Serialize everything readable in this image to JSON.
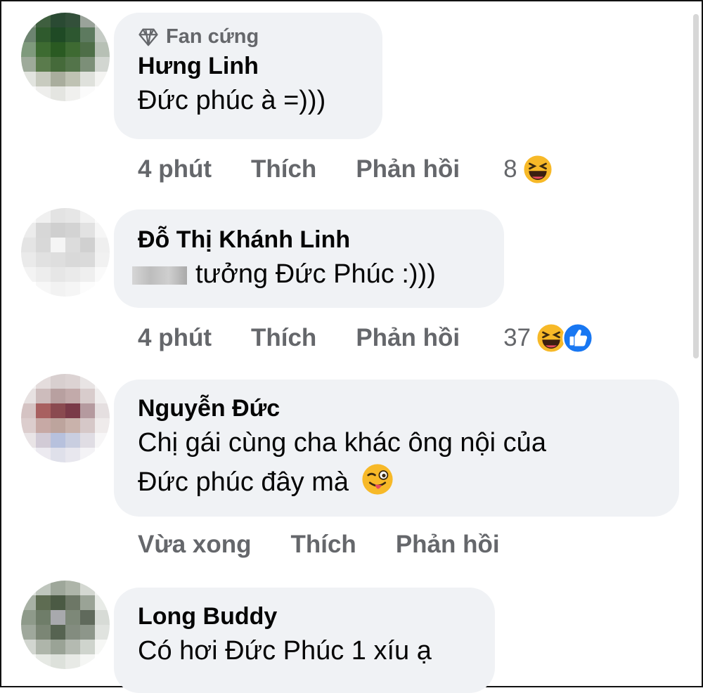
{
  "comments": [
    {
      "badge": "Fan cứng",
      "name": "Hưng Linh",
      "text": "Đức phúc à =)))",
      "time": "4 phút",
      "like": "Thích",
      "reply": "Phản hồi",
      "reaction_count": "8"
    },
    {
      "name": "Đỗ Thị Khánh Linh",
      "text": "tưởng Đức Phúc :)))",
      "time": "4 phút",
      "like": "Thích",
      "reply": "Phản hồi",
      "reaction_count": "37"
    },
    {
      "name": "Nguyễn Đức",
      "text_line1": "Chị gái cùng cha khác ông nội của",
      "text_line2": "Đức phúc đây mà",
      "time": "Vừa xong",
      "like": "Thích",
      "reply": "Phản hồi"
    },
    {
      "name": "Long Buddy",
      "text": "Có hơi Đức Phúc 1 xíu ạ"
    }
  ],
  "icons": {
    "badge": "diamond-icon",
    "haha": "haha-reaction-icon",
    "like": "like-reaction-icon",
    "wink_tongue": "winking-tongue-emoji-icon"
  },
  "colors": {
    "bubble": "#f0f2f5",
    "meta_text": "#65676b",
    "like_blue": "#1877f2",
    "haha_yellow": "#f7b928"
  }
}
